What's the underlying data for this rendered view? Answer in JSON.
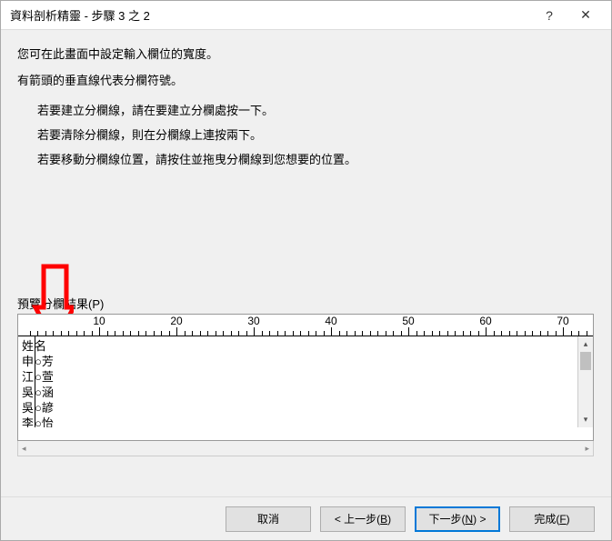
{
  "titlebar": {
    "title": "資料剖析精靈 - 步驟 3 之 2",
    "help": "?",
    "close": "✕"
  },
  "content": {
    "intro1": "您可在此畫面中設定輸入欄位的寬度。",
    "intro2": "有箭頭的垂直線代表分欄符號。",
    "bullet1": "若要建立分欄線，請在要建立分欄處按一下。",
    "bullet2": "若要清除分欄線，則在分欄線上連按兩下。",
    "bullet3": "若要移動分欄線位置，請按住並拖曳分欄線到您想要的位置。",
    "preview_label": "預覽分欄結果(P)"
  },
  "ruler": {
    "ticks": [
      10,
      20,
      30,
      40,
      50,
      60,
      70
    ]
  },
  "data_rows": [
    {
      "c1": "姓",
      "c2": "名"
    },
    {
      "c1": "申",
      "c2": "○芳"
    },
    {
      "c1": "江",
      "c2": "○萱"
    },
    {
      "c1": "吳",
      "c2": "○涵"
    },
    {
      "c1": "吳",
      "c2": "○諺"
    },
    {
      "c1": "李",
      "c2": "○怡"
    }
  ],
  "buttons": {
    "cancel": "取消",
    "back_prefix": "< 上一步(",
    "back_key": "B",
    "back_suffix": ")",
    "next_prefix": "下一步(",
    "next_key": "N",
    "next_suffix": ") >",
    "finish_prefix": "完成(",
    "finish_key": "F",
    "finish_suffix": ")"
  }
}
